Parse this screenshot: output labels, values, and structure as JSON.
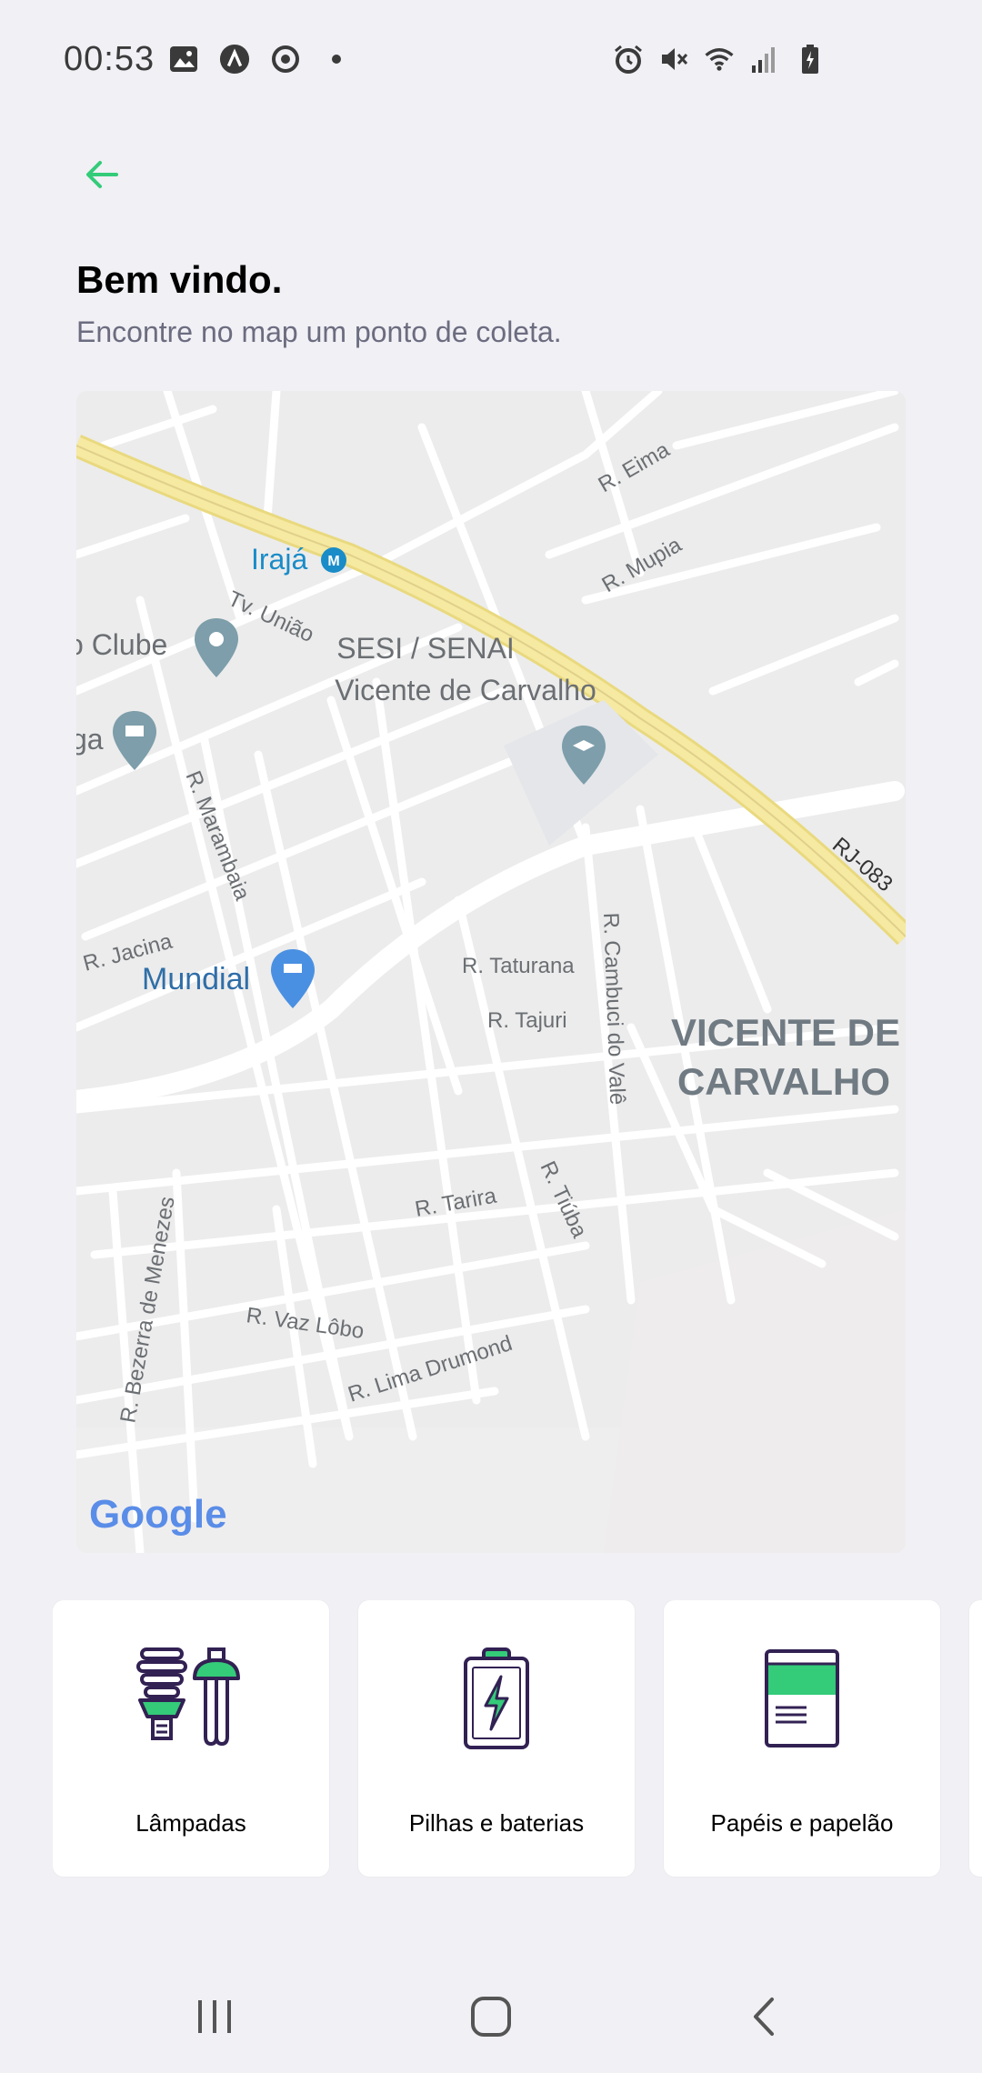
{
  "status_bar": {
    "time": "00:53",
    "left_icons": [
      "gallery-icon",
      "app-a-icon",
      "sync-icon",
      "dot-icon"
    ],
    "right_icons": [
      "alarm-icon",
      "mute-icon",
      "wifi-icon",
      "signal-icon",
      "battery-icon"
    ]
  },
  "header": {
    "back_icon": "arrow-left-icon",
    "title": "Bem vindo.",
    "subtitle": "Encontre no map um ponto de coleta."
  },
  "map": {
    "labels": {
      "iraja": "Irajá",
      "tv_uniao": "Tv. União",
      "clube": "o Clube",
      "sesi_1": "SESI / SENAI",
      "sesi_2": "Vicente de Carvalho",
      "r_eima": "R. Eima",
      "r_mupia": "R. Mupia",
      "rj_083": "RJ-083",
      "ga": "ga",
      "r_marambaia": "R. Marambaia",
      "r_jacina": "R. Jacina",
      "mundial": "Mundial",
      "r_taturana": "R. Taturana",
      "r_tajuri": "R. Tajuri",
      "r_cambuci": "R. Cambuci do Valê",
      "vicente_1": "VICENTE DE",
      "vicente_2": "CARVALHO",
      "r_tarira": "R. Tarira",
      "r_tiuba": "R. Tiúba",
      "r_bezerra": "R. Bezerra de Menezes",
      "r_vaz_lobo": "R. Vaz Lôbo",
      "r_lima": "R. Lima Drumond",
      "google": "Google"
    },
    "colors": {
      "background": "#ececec",
      "road": "#ffffff",
      "highway": "#f6e9a2",
      "pin": "#7d9eaa",
      "shop_pin": "#4a90e2",
      "metro": "#1a8cc8",
      "label": "#6b6f73"
    }
  },
  "items": [
    {
      "label": "Lâmpadas",
      "icon": "lamps-icon"
    },
    {
      "label": "Pilhas e baterias",
      "icon": "battery-item-icon"
    },
    {
      "label": "Papéis e papelão",
      "icon": "paper-icon"
    }
  ],
  "colors": {
    "accent": "#34cb79",
    "text_dark": "#322153"
  },
  "nav_bar": {
    "buttons": [
      "recent-apps-icon",
      "home-icon",
      "back-nav-icon"
    ]
  }
}
